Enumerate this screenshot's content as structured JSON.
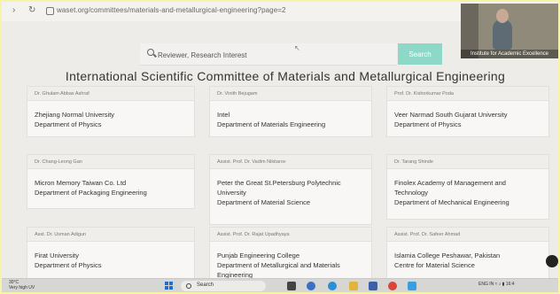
{
  "browser": {
    "url": "waset.org/committees/materials-and-metallurgical-engineering?page=2"
  },
  "webcam": {
    "caption": "Institute for Academic Excellence"
  },
  "search": {
    "placeholder": "Reviewer, Research Interest",
    "button_label": "Search"
  },
  "page_title": "International Scientific Committee of Materials and Metallurgical Engineering",
  "members": [
    {
      "name": "Dr. Ghulam Abbas Ashraf",
      "lines": [
        "Zhejiang Normal University",
        "Department of Physics"
      ]
    },
    {
      "name": "Dr. Vinith Bejugam",
      "lines": [
        "Intel",
        "Department of Materials Engineering"
      ]
    },
    {
      "name": "Prof. Dr. Kishorkumar Poda",
      "lines": [
        "Veer Narmad South Gujarat University",
        "Department of Physics"
      ]
    },
    {
      "name": "Dr. Chang-Leong Gan",
      "lines": [
        "Micron Memory Taiwan Co. Ltd",
        "Department of Packaging Engineering"
      ]
    },
    {
      "name": "Assist. Prof. Dr. Vadim Nikitarov",
      "lines": [
        "Peter the Great St.Petersburg Polytechnic",
        "University",
        "Department of Material Science"
      ]
    },
    {
      "name": "Dr. Tarang Shinde",
      "lines": [
        "Finolex Academy of Management and",
        "Technology",
        "Department of Mechanical Engineering"
      ]
    },
    {
      "name": "Asst. Dr. Usman Adigun",
      "lines": [
        "Firat University",
        "Department of Physics"
      ]
    },
    {
      "name": "Assist. Prof. Dr. Rajat Upadhyaya",
      "lines": [
        "Punjab Engineering College",
        "Department of Metallurgical and Materials",
        "Engineering"
      ]
    },
    {
      "name": "Assist. Prof. Dr. Safeer Ahmad",
      "lines": [
        "Islamia College Peshawar, Pakistan",
        "Centre for Material Science"
      ]
    }
  ],
  "taskbar": {
    "weather_temp": "30°C",
    "weather_desc": "Very high UV",
    "search_label": "Search",
    "tray_lang": "ENG",
    "tray_region": "IN",
    "tray_time": "16:4"
  },
  "colors": {
    "accent": "#8ed8c8",
    "start_blue": "#1f6fd1"
  }
}
